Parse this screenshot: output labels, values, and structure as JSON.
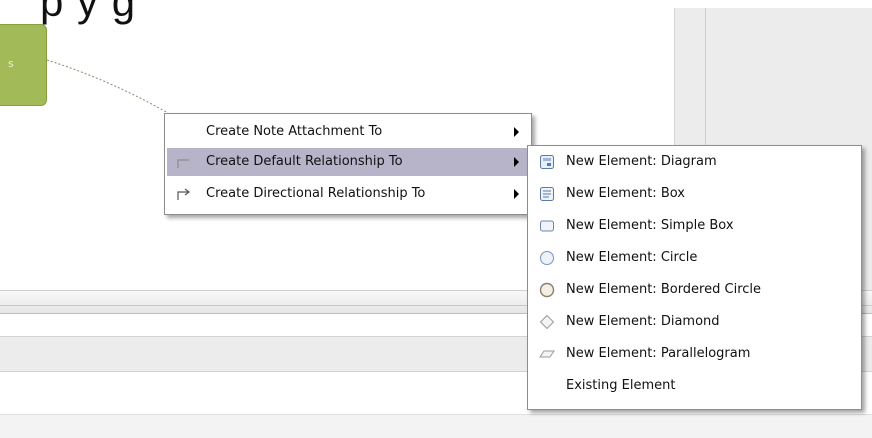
{
  "canvas": {
    "title_fragment": "p y g",
    "node_label": "s"
  },
  "context_menu": {
    "items": [
      {
        "label": "Create Note Attachment To",
        "icon": "none",
        "has_submenu": true,
        "highlighted": false
      },
      {
        "label": "Create Default Relationship To",
        "icon": "default-relationship-icon",
        "has_submenu": true,
        "highlighted": true
      },
      {
        "label": "Create Directional Relationship To",
        "icon": "directional-relationship-icon",
        "has_submenu": true,
        "highlighted": false
      }
    ]
  },
  "submenu": {
    "items": [
      {
        "label": "New Element: Diagram",
        "icon": "diagram-icon"
      },
      {
        "label": "New Element: Box",
        "icon": "box-icon"
      },
      {
        "label": "New Element: Simple Box",
        "icon": "simple-box-icon"
      },
      {
        "label": "New Element: Circle",
        "icon": "circle-icon"
      },
      {
        "label": "New Element: Bordered Circle",
        "icon": "bordered-circle-icon"
      },
      {
        "label": "New Element: Diamond",
        "icon": "diamond-icon"
      },
      {
        "label": "New Element: Parallelogram",
        "icon": "parallelogram-icon"
      },
      {
        "label": "Existing Element",
        "icon": "none"
      }
    ]
  },
  "colors": {
    "highlight": "#b7b3c9",
    "node_fill": "#a2bb58"
  }
}
